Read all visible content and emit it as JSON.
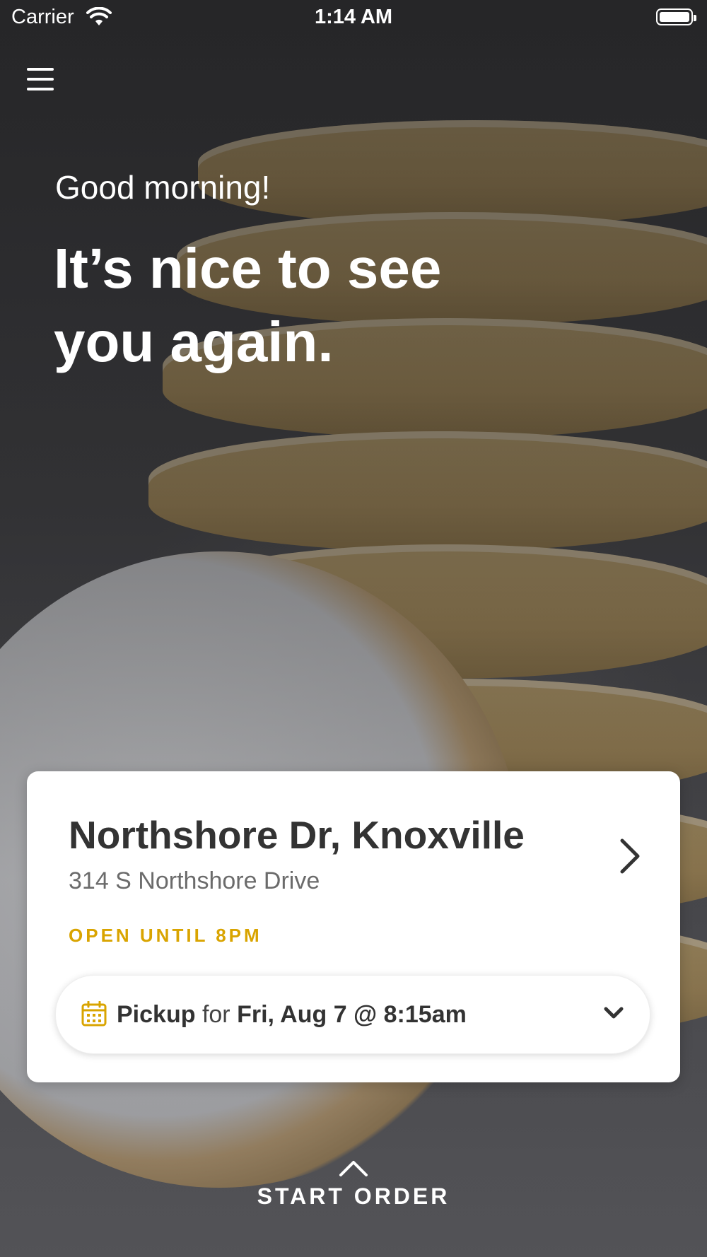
{
  "status_bar": {
    "carrier": "Carrier",
    "time": "1:14 AM"
  },
  "hero": {
    "greeting": "Good morning!",
    "headline": "It’s nice to see you again."
  },
  "store_card": {
    "name": "Northshore Dr, Knoxville",
    "address": "314 S Northshore Drive",
    "hours": "OPEN UNTIL 8PM",
    "pickup": {
      "mode": "Pickup",
      "connector": "for",
      "datetime": "Fri, Aug 7 @ 8:15am"
    }
  },
  "footer": {
    "start_order_label": "START ORDER"
  },
  "colors": {
    "accent": "#D9A400",
    "card_bg": "#FFFFFF",
    "text_dark": "#333333"
  }
}
